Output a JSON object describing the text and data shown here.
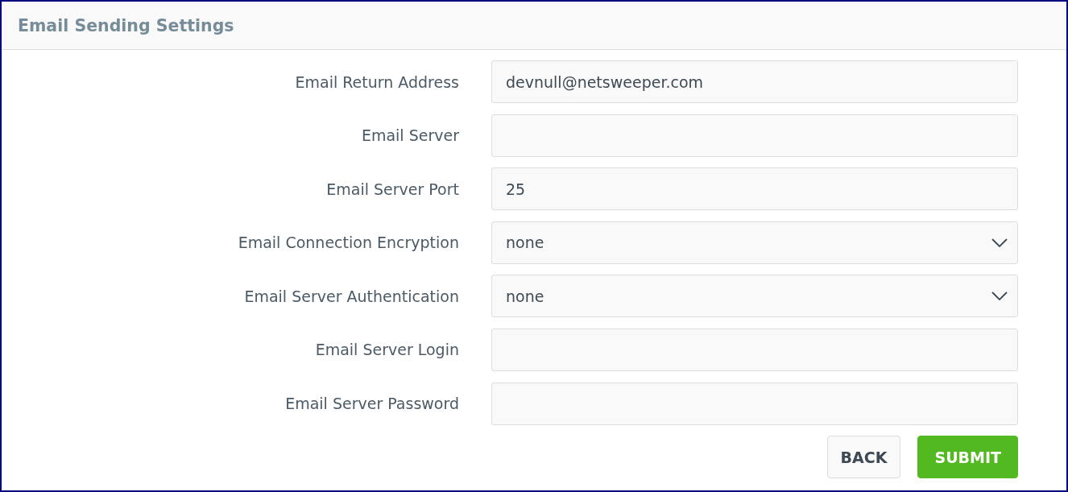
{
  "header": {
    "title": "Email Sending Settings"
  },
  "fields": [
    {
      "label": "Email Return Address",
      "kind": "text",
      "value": "devnull@netsweeper.com"
    },
    {
      "label": "Email Server",
      "kind": "text"
    },
    {
      "label": "Email Server Port",
      "kind": "text",
      "value": "25"
    },
    {
      "label": "Email Connection Encryption",
      "kind": "select",
      "value": "none"
    },
    {
      "label": "Email Server Authentication",
      "kind": "select",
      "value": "none"
    },
    {
      "label": "Email Server Login",
      "kind": "text"
    },
    {
      "label": "Email Server Password",
      "kind": "password"
    }
  ],
  "buttons": [
    {
      "label": "BACK",
      "kind": "secondary"
    },
    {
      "label": "SUBMIT",
      "kind": "primary"
    }
  ]
}
